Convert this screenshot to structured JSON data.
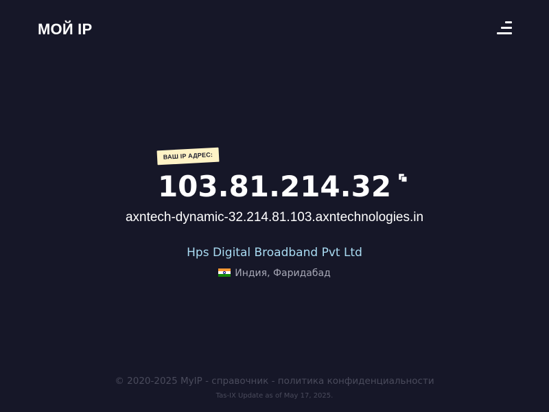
{
  "header": {
    "logo": "МОЙ IP",
    "menu_icon": "hamburger-menu-icon"
  },
  "main": {
    "badge": "ВАШ IP АДРЕС:",
    "ip": "103.81.214.32",
    "copy_icon": "copy-icon",
    "hostname": "axntech-dynamic-32.214.81.103.axntechnologies.in",
    "isp": "Hps Digital Broadband Pvt Ltd",
    "flag_icon": "india-flag-icon",
    "location": "Индия, Фаридабад"
  },
  "colors": {
    "background": "#161728",
    "badge_bg": "#fff3c6",
    "isp_text": "#a9dbf2",
    "muted_text": "#4a4b5c"
  },
  "footer": {
    "copyright": "© 2020-2025 MyIP",
    "separator": " - ",
    "link_reference": "справочник",
    "link_privacy": "политика конфиденциальности",
    "tasix": "Tas-IX Update as of May 17, 2025."
  }
}
